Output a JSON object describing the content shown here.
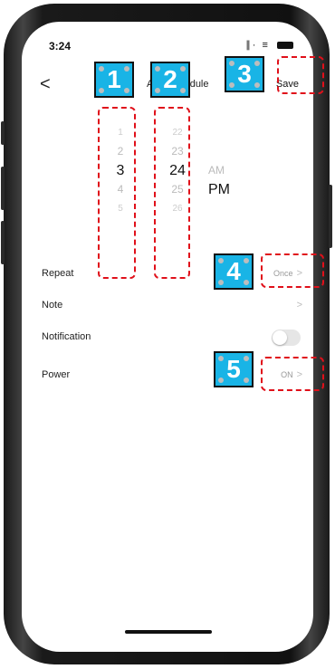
{
  "status_bar": {
    "time": "3:24",
    "signal": "∥·",
    "wifi": "≡"
  },
  "nav": {
    "back_symbol": "<",
    "title": "Add Schedule",
    "save_label": "Save"
  },
  "picker": {
    "hours": [
      "1",
      "2",
      "3",
      "4",
      "5"
    ],
    "minutes": [
      "22",
      "23",
      "24",
      "25",
      "26"
    ],
    "ampm": [
      "AM",
      "PM"
    ]
  },
  "settings": {
    "repeat": {
      "label": "Repeat",
      "value": "Once",
      "chevron": ">"
    },
    "note": {
      "label": "Note",
      "chevron": ">"
    },
    "notification": {
      "label": "Notification",
      "enabled": false
    },
    "power": {
      "label": "Power",
      "value": "ON",
      "chevron": ">"
    }
  },
  "annotations": [
    "1",
    "2",
    "3",
    "4",
    "5"
  ],
  "colors": {
    "badge": "#19b4e6",
    "dash": "#e0101a"
  }
}
